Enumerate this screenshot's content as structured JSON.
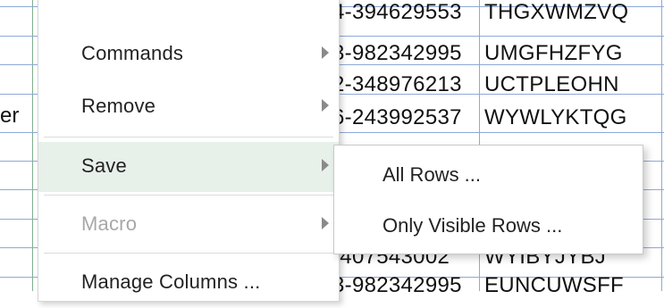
{
  "grid": {
    "left_partial_text": "er",
    "rows": [
      {
        "id": "4-394629553",
        "code": "THGXWMZVQ"
      },
      {
        "id": "3-982342995",
        "code": "UMGFHZFYG"
      },
      {
        "id": "2-348976213",
        "code": "UCTPLEOHN"
      },
      {
        "id": "6-243992537",
        "code": "WYWLYKTQG"
      },
      {
        "id": "-407543002",
        "code": "WYIBYJYBJ"
      },
      {
        "id": "3-982342995",
        "code": "EUNCUWSFF"
      }
    ]
  },
  "context_menu": {
    "items": [
      {
        "label": "Commands",
        "has_submenu": true,
        "enabled": true
      },
      {
        "label": "Remove",
        "has_submenu": true,
        "enabled": true
      },
      {
        "label": "Save",
        "has_submenu": true,
        "enabled": true,
        "highlighted": true
      },
      {
        "label": "Macro",
        "has_submenu": true,
        "enabled": false
      },
      {
        "label": "Manage Columns ...",
        "has_submenu": false,
        "enabled": true
      }
    ]
  },
  "save_submenu": {
    "items": [
      {
        "label": "All Rows ..."
      },
      {
        "label": "Only Visible Rows ..."
      }
    ]
  }
}
